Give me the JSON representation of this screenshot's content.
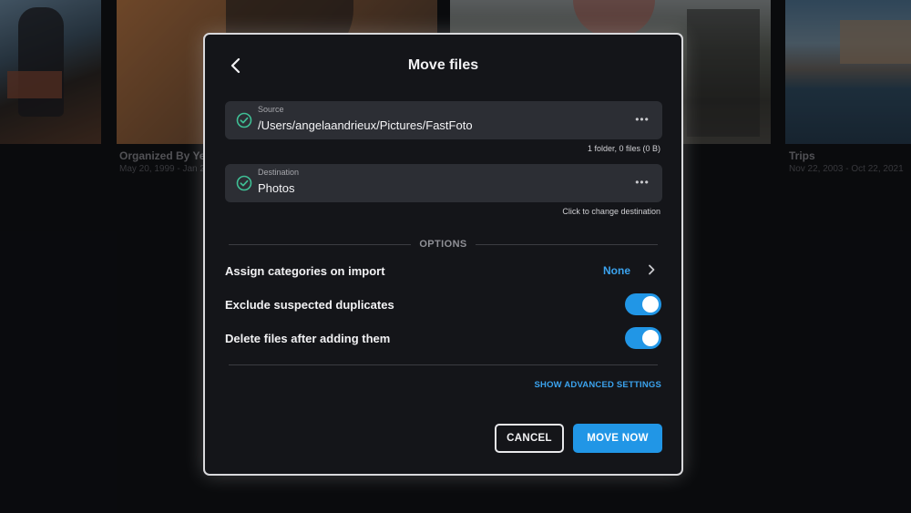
{
  "background": {
    "albums": [
      {
        "title": "Organized By Ye",
        "date": "May 20, 1999 - Jan 2"
      },
      {
        "title": "Trips",
        "date": "Nov 22, 2003 - Oct 22, 2021"
      }
    ]
  },
  "dialog": {
    "title": "Move files",
    "back_icon": "chevron-left-icon",
    "source": {
      "label": "Source",
      "value": "/Users/angelaandrieux/Pictures/FastFoto",
      "more": "•••",
      "hint": "1 folder, 0 files (0 B)",
      "icon": "check-circle-icon"
    },
    "destination": {
      "label": "Destination",
      "value": "Photos",
      "more": "•••",
      "hint": "Click to change destination",
      "icon": "check-circle-icon"
    },
    "options_heading": "OPTIONS",
    "options": {
      "categories": {
        "label": "Assign categories on import",
        "value": "None"
      },
      "exclude_duplicates": {
        "label": "Exclude suspected duplicates",
        "enabled": true
      },
      "delete_after": {
        "label": "Delete files after adding them",
        "enabled": true
      }
    },
    "advanced_link": "SHOW ADVANCED SETTINGS",
    "cancel_label": "CANCEL",
    "move_label": "MOVE NOW",
    "colors": {
      "accent": "#2196e6",
      "link": "#3ba3ee",
      "check": "#3fbf95"
    }
  }
}
